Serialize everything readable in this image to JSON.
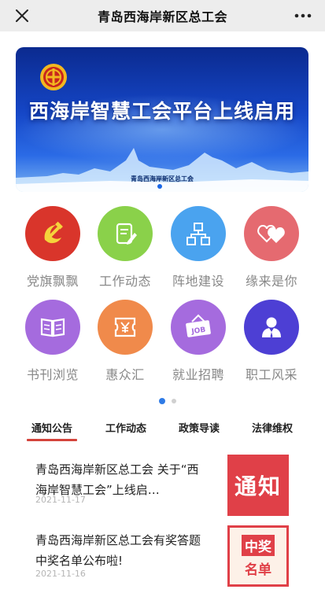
{
  "topbar": {
    "title": "青岛西海岸新区总工会",
    "close_icon": "close-icon",
    "more_icon": "more-icon"
  },
  "banner": {
    "headline": "西海岸智慧工会平台上线启用",
    "subtitle": "青岛西海岸新区总工会",
    "logo_icon": "union-emblem-icon"
  },
  "grid": {
    "items": [
      {
        "label": "党旗飘飘",
        "icon": "hammer-sickle-icon",
        "color": "#d9352b"
      },
      {
        "label": "工作动态",
        "icon": "edit-document-icon",
        "color": "#8ad14a"
      },
      {
        "label": "阵地建设",
        "icon": "org-chart-icon",
        "color": "#4aa3ef"
      },
      {
        "label": "缘来是你",
        "icon": "hearts-icon",
        "color": "#e56a70"
      },
      {
        "label": "书刊浏览",
        "icon": "open-book-icon",
        "color": "#a56bde"
      },
      {
        "label": "惠众汇",
        "icon": "yen-ticket-icon",
        "color": "#f08a4b"
      },
      {
        "label": "就业招聘",
        "icon": "job-sign-icon",
        "color": "#a56bde"
      },
      {
        "label": "职工风采",
        "icon": "worker-icon",
        "color": "#4d3fd4"
      }
    ]
  },
  "tabs": [
    {
      "label": "通知公告",
      "active": true
    },
    {
      "label": "工作动态",
      "active": false
    },
    {
      "label": "政策导读",
      "active": false
    },
    {
      "label": "法律维权",
      "active": false
    }
  ],
  "news": [
    {
      "title": "青岛西海岸新区总工会 关于“西海岸智慧工会”上线启…",
      "date": "2021-11-17",
      "thumb_text": "通知",
      "thumb_color": "#e04048"
    },
    {
      "title": "青岛西海岸新区总工会有奖答题中奖名单公布啦!",
      "date": "2021-11-16",
      "thumb_text_1": "中奖",
      "thumb_text_2": "名单",
      "thumb_color": "#e04048"
    }
  ]
}
